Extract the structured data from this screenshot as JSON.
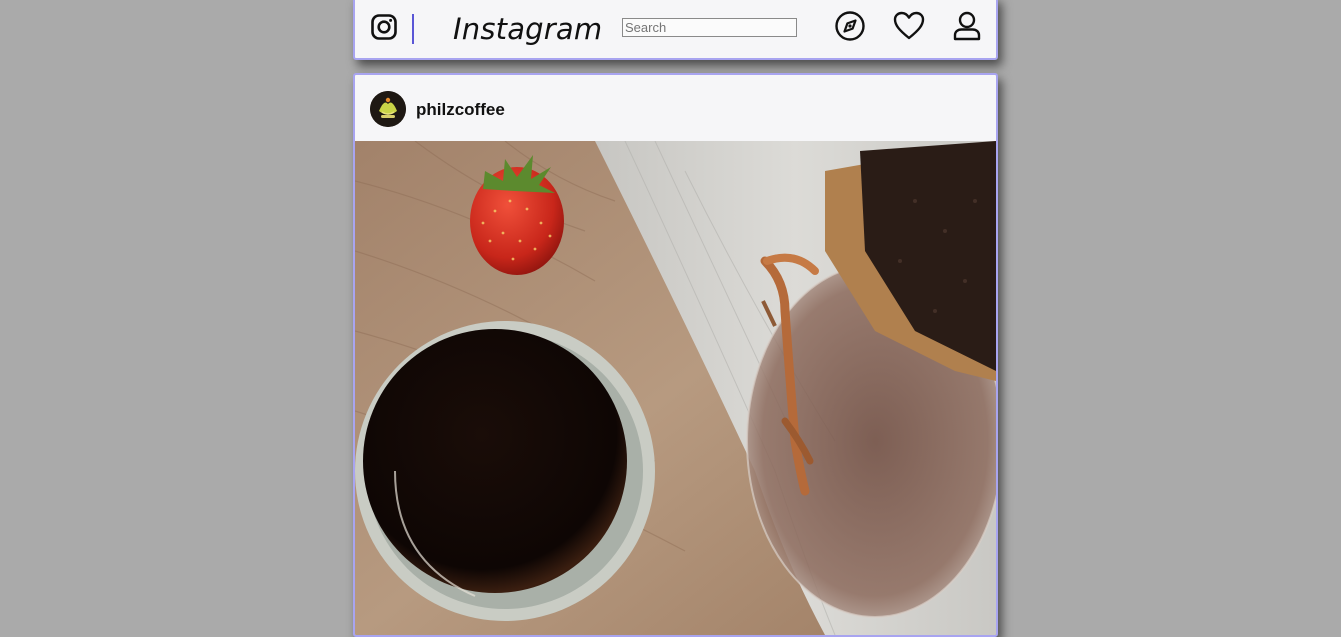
{
  "app": {
    "brand": "Instagram"
  },
  "navbar": {
    "search": {
      "placeholder": "Search",
      "value": ""
    },
    "icons": [
      "instagram-logo-icon",
      "explore-compass-icon",
      "heart-icon",
      "profile-icon"
    ]
  },
  "post": {
    "username": "philzcoffee",
    "avatar_text": "Philz Coffee",
    "image_alt": "coffee-cup-strawberry-pour-over-photo"
  },
  "colors": {
    "page_background": "#aaaaaa",
    "card_background": "#f6f6f8",
    "card_border": "#a8a4f0",
    "divider": "#5a56d6",
    "text": "#111111"
  }
}
